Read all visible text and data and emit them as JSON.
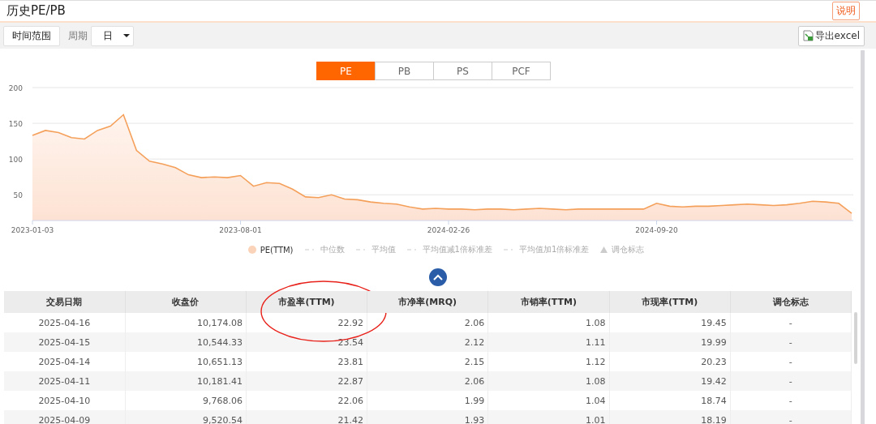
{
  "header": {
    "title": "历史PE/PB",
    "help_button": "说明"
  },
  "toolbar": {
    "range_button": "时间范围",
    "period_label": "周期",
    "period_select": "日",
    "export_button": "导出excel"
  },
  "tabs": [
    {
      "label": "PE",
      "selected": true
    },
    {
      "label": "PB",
      "selected": false
    },
    {
      "label": "PS",
      "selected": false
    },
    {
      "label": "PCF",
      "selected": false
    }
  ],
  "chart": {
    "chart_data": {
      "type": "area",
      "categories": [
        "2023-01-03",
        null,
        null,
        null,
        null,
        null,
        null,
        null,
        null,
        null,
        null,
        null,
        null,
        null,
        null,
        null,
        "2023-08-01",
        null,
        null,
        null,
        null,
        null,
        null,
        null,
        null,
        null,
        null,
        null,
        null,
        null,
        null,
        null,
        "2024-02-26",
        null,
        null,
        null,
        null,
        null,
        null,
        null,
        null,
        null,
        null,
        null,
        null,
        null,
        null,
        null,
        "2024-09-20",
        null,
        null,
        null,
        null,
        null,
        null,
        null,
        null,
        null,
        null,
        null,
        null,
        null,
        null,
        null
      ],
      "series": [
        {
          "name": "PE(TTM)",
          "color": "#f5a05a",
          "values": [
            133,
            140,
            137,
            130,
            128,
            140,
            146,
            162,
            112,
            97,
            93,
            88,
            78,
            74,
            75,
            74,
            77,
            62,
            67,
            66,
            58,
            47,
            46,
            50,
            44,
            43,
            40,
            38,
            37,
            33,
            30,
            31,
            30,
            30,
            29,
            30,
            30,
            29,
            30,
            31,
            30,
            29,
            30,
            30,
            30,
            30,
            30,
            30,
            38,
            34,
            33,
            34,
            34,
            35,
            36,
            37,
            36,
            35,
            36,
            38,
            41,
            40,
            38,
            24
          ]
        }
      ],
      "ylim": [
        14,
        200
      ],
      "yticks": [
        50,
        100,
        150,
        200
      ],
      "grid": true
    },
    "legend": [
      {
        "kind": "dot",
        "on": true
      },
      {
        "label": "中位数",
        "kind": "dash",
        "on": false
      },
      {
        "label": "平均值",
        "kind": "dash",
        "on": false
      },
      {
        "label": "平均值减1倍标准差",
        "kind": "dash",
        "on": false
      },
      {
        "label": "平均值加1倍标准差",
        "kind": "dash",
        "on": false
      },
      {
        "label": "调仓标志",
        "kind": "triangle",
        "on": false
      }
    ]
  },
  "table": {
    "columns": [
      {
        "label": "交易日期",
        "circled": false
      },
      {
        "label": "收盘价",
        "circled": false
      },
      {
        "label": "市盈率(TTM)",
        "circled": true
      },
      {
        "label": "市净率(MRQ)",
        "circled": false
      },
      {
        "label": "市销率(TTM)",
        "circled": false
      },
      {
        "label": "市现率(TTM)",
        "circled": false
      },
      {
        "label": "调仓标志",
        "circled": false
      }
    ],
    "rows": [
      [
        "2025-04-16",
        "10,174.08",
        "22.92",
        "2.06",
        "1.08",
        "19.45",
        "-"
      ],
      [
        "2025-04-15",
        "10,544.33",
        "23.54",
        "2.12",
        "1.11",
        "19.99",
        "-"
      ],
      [
        "2025-04-14",
        "10,651.13",
        "23.81",
        "2.15",
        "1.12",
        "20.23",
        "-"
      ],
      [
        "2025-04-11",
        "10,181.41",
        "22.87",
        "2.06",
        "1.08",
        "19.42",
        "-"
      ],
      [
        "2025-04-10",
        "9,768.06",
        "22.06",
        "1.99",
        "1.04",
        "18.74",
        "-"
      ],
      [
        "2025-04-09",
        "9,520.54",
        "21.42",
        "1.93",
        "1.01",
        "18.19",
        "-"
      ]
    ]
  }
}
